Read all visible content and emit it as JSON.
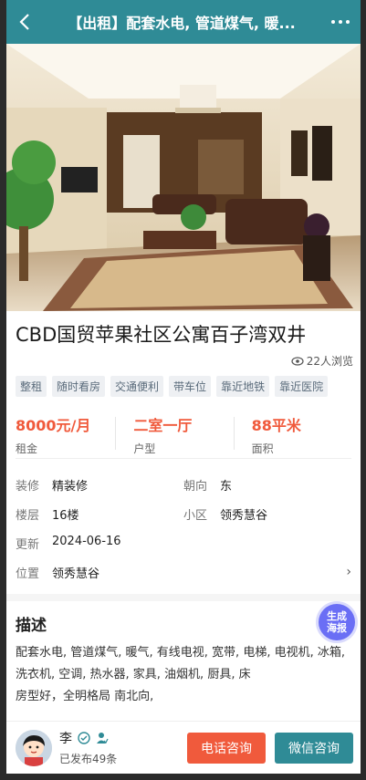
{
  "header": {
    "title": "【出租】配套水电, 管道煤气, 暖..."
  },
  "listing": {
    "title": "CBD国贸苹果社区公寓百子湾双井",
    "views": "22人浏览",
    "tags": [
      "整租",
      "随时看房",
      "交通便利",
      "带车位",
      "靠近地铁",
      "靠近医院"
    ],
    "stats": [
      {
        "value": "8000元/月",
        "label": "租金"
      },
      {
        "value": "二室一厅",
        "label": "户型"
      },
      {
        "value": "88平米",
        "label": "面积"
      }
    ],
    "details": {
      "decor_label": "装修",
      "decor_value": "精装修",
      "facing_label": "朝向",
      "facing_value": "东",
      "floor_label": "楼层",
      "floor_value": "16楼",
      "community_label": "小区",
      "community_value": "领秀慧谷",
      "updated_label": "更新",
      "updated_value": "2024-06-16",
      "location_label": "位置",
      "location_value": "领秀慧谷"
    },
    "description": {
      "heading": "描述",
      "line1": "配套水电, 管道煤气, 暖气, 有线电视, 宽带, 电梯, 电视机, 冰箱, 洗衣机, 空调, 热水器, 家具, 油烟机, 厨具, 床",
      "line2": "房型好，全明格局 南北向,"
    }
  },
  "poster_button": {
    "line1": "生成",
    "line2": "海报"
  },
  "owner": {
    "name": "李",
    "posts": "已发布49条"
  },
  "actions": {
    "call": "电话咨询",
    "wechat": "微信咨询"
  },
  "colors": {
    "brand": "#2f8b96",
    "accent": "#f05a3c",
    "poster": "#6a6ef5"
  },
  "icons": [
    "back-icon",
    "more-icon",
    "eye-icon",
    "chevron-right-icon",
    "verified-icon",
    "user-check-icon"
  ]
}
